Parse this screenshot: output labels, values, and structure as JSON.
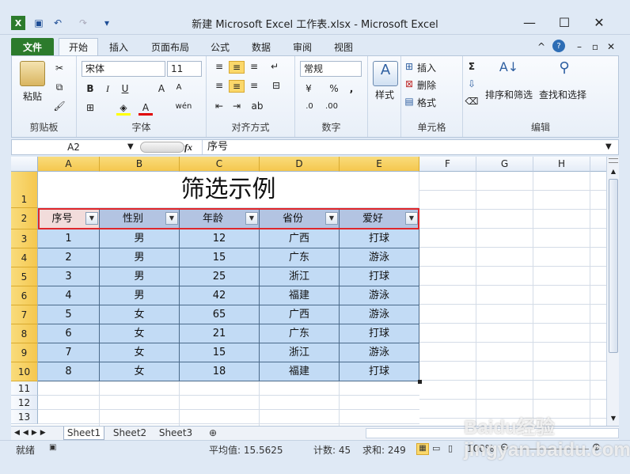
{
  "window": {
    "title": "新建 Microsoft Excel 工作表.xlsx  -  Microsoft Excel",
    "minimize": "—",
    "maximize": "☐",
    "close": "✕"
  },
  "ribbon_tabs": [
    {
      "label": "文件"
    },
    {
      "label": "开始"
    },
    {
      "label": "插入"
    },
    {
      "label": "页面布局"
    },
    {
      "label": "公式"
    },
    {
      "label": "数据"
    },
    {
      "label": "审阅"
    },
    {
      "label": "视图"
    }
  ],
  "ribbon": {
    "clipboard": {
      "paste": "粘贴",
      "label": "剪贴板"
    },
    "font": {
      "name": "宋体",
      "size": "11",
      "bold": "B",
      "italic": "I",
      "underline": "U",
      "grow": "A",
      "shrink": "A",
      "color": "A",
      "wen": "wén",
      "label": "字体"
    },
    "align": {
      "label": "对齐方式"
    },
    "number": {
      "format": "常规",
      "percent": "%",
      "comma": ",",
      "label": "数字"
    },
    "style": {
      "label": "样式"
    },
    "cells": {
      "insert": "插入",
      "delete": "删除",
      "format": "格式",
      "label": "单元格"
    },
    "edit": {
      "sum": "Σ",
      "sort_filter": "排序和筛选",
      "find_select": "查找和选择",
      "label": "编辑"
    }
  },
  "formula_bar": {
    "namebox": "A2",
    "fx": "fx",
    "content": "序号"
  },
  "columns": [
    "A",
    "B",
    "C",
    "D",
    "E",
    "F",
    "G",
    "H"
  ],
  "rows": [
    "1",
    "2",
    "3",
    "4",
    "5",
    "6",
    "7",
    "8",
    "9",
    "10",
    "11",
    "12",
    "13"
  ],
  "sheet": {
    "title": "筛选示例",
    "headers": [
      "序号",
      "性别",
      "年龄",
      "省份",
      "爱好"
    ],
    "data": [
      [
        "1",
        "男",
        "12",
        "广西",
        "打球"
      ],
      [
        "2",
        "男",
        "15",
        "广东",
        "游泳"
      ],
      [
        "3",
        "男",
        "25",
        "浙江",
        "打球"
      ],
      [
        "4",
        "男",
        "42",
        "福建",
        "游泳"
      ],
      [
        "5",
        "女",
        "65",
        "广西",
        "游泳"
      ],
      [
        "6",
        "女",
        "21",
        "广东",
        "打球"
      ],
      [
        "7",
        "女",
        "15",
        "浙江",
        "游泳"
      ],
      [
        "8",
        "女",
        "18",
        "福建",
        "打球"
      ]
    ]
  },
  "sheet_tabs": [
    "Sheet1",
    "Sheet2",
    "Sheet3"
  ],
  "status": {
    "ready": "就绪",
    "average": "平均值: 15.5625",
    "count": "计数: 45",
    "sum": "求和: 249",
    "zoom": "100%"
  },
  "watermark": "Baidu经验 jingyan.baidu.com"
}
